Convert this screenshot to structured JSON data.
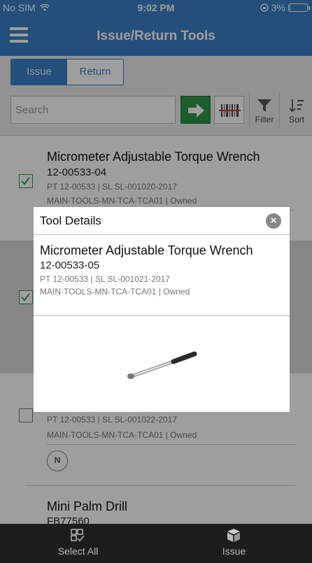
{
  "status": {
    "carrier": "No SIM",
    "time": "9:02 PM",
    "battery": "3%",
    "battery_level": 0.03
  },
  "header": {
    "title": "Issue/Return Tools"
  },
  "mode_tabs": {
    "issue": "Issue",
    "return": "Return",
    "selected": "Issue"
  },
  "search": {
    "placeholder": "Search",
    "filter_label": "Filter",
    "sort_label": "Sort"
  },
  "items": [
    {
      "name": "Micrometer Adjustable Torque Wrench",
      "number": "12-00533-04",
      "meta": "PT 12-00533 | SL SL-001020-2017",
      "location": "MAIN-TOOLS-MN-TCA-TCA01 | Owned",
      "checked": true
    },
    {
      "name": "",
      "number": "",
      "meta": "",
      "location": "",
      "checked": true
    },
    {
      "name": "",
      "number": "",
      "meta": "PT 12-00533 | SL SL-001022-2017",
      "location": "MAIN-TOOLS-MN-TCA-TCA01 | Owned",
      "badge": "N",
      "checked": false
    },
    {
      "name": "Mini Palm Drill",
      "number": "FB77560"
    }
  ],
  "dialog": {
    "title": "Tool Details",
    "close_icon": "×",
    "name": "Micrometer Adjustable Torque Wrench",
    "number": "12-00533-05",
    "meta": "PT 12-00533 | SL SL-001021-2017",
    "location": "MAIN-TOOLS-MN-TCA-TCA01 | Owned"
  },
  "bottom_tabs": {
    "select_all": "Select All",
    "issue": "Issue"
  },
  "colors": {
    "accent": "#3a80c6",
    "go_button": "#2e9648",
    "tabbar": "#1d1d1d"
  }
}
